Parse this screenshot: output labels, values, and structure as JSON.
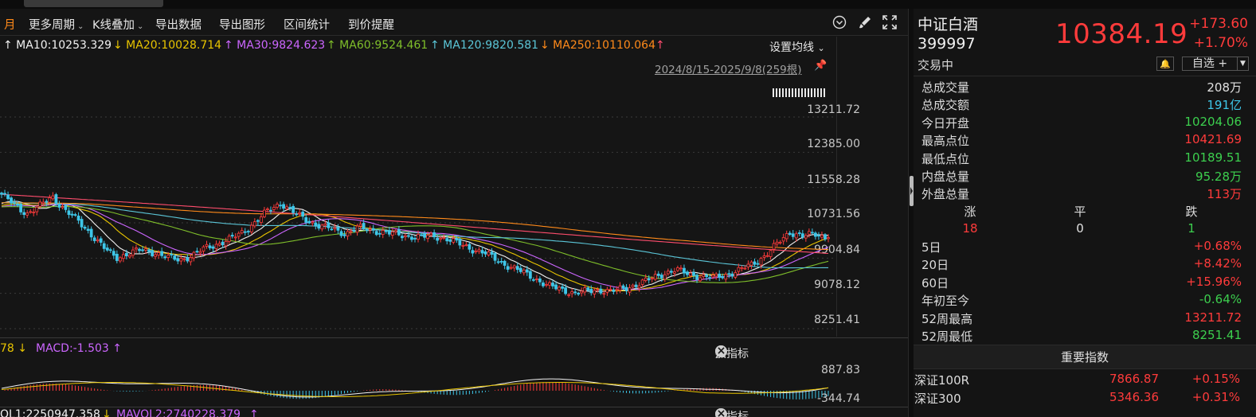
{
  "toolbar": {
    "period_partial": "月",
    "more_periods": "更多周期",
    "kline_overlay": "K线叠加",
    "export_data": "导出数据",
    "export_image": "导出图形",
    "range_stats": "区间统计",
    "price_alert": "到价提醒"
  },
  "ma": {
    "items": [
      {
        "label": "↑ MA10:10253.329",
        "color": "#f2f2f2"
      },
      {
        "label": "↓ MA20:10028.714",
        "color": "#e8c400"
      },
      {
        "label": "↑ MA30:9824.623",
        "color": "#cc66ff"
      },
      {
        "label": "↑ MA60:9524.461",
        "color": "#7fbf2a"
      },
      {
        "label": "↑ MA120:9820.581",
        "color": "#5bc6d8"
      },
      {
        "label": "↓ MA250:10110.064",
        "color": "#ff8a1a"
      },
      {
        "label": "↑",
        "color": "#ff4d6d"
      }
    ],
    "setting": "设置均线",
    "date_range": "2024/8/15-2025/9/8(259根)"
  },
  "price_axis": [
    "13211.72",
    "12385.00",
    "11558.28",
    "10731.56",
    "9904.84",
    "9078.12",
    "8251.41"
  ],
  "chart_data": {
    "type": "candlestick",
    "title": "",
    "period": "2024/8/15-2025/9/8",
    "bars": 259,
    "ylim": [
      8251.41,
      13211.72
    ],
    "price_ticks": [
      13211.72,
      12385.0,
      11558.28,
      10731.56,
      9904.84,
      9078.12,
      8251.41
    ],
    "last_close": 10384.19,
    "ma": {
      "MA10": 10253.329,
      "MA20": 10028.714,
      "MA30": 9824.623,
      "MA60": 9524.461,
      "MA120": 9820.581,
      "MA250": 10110.064
    },
    "close_path": [
      11400,
      11150,
      10950,
      11120,
      11350,
      11020,
      10780,
      10480,
      10150,
      9920,
      10010,
      10100,
      10040,
      9920,
      9870,
      9960,
      10140,
      10240,
      10350,
      10520,
      10760,
      11030,
      11200,
      10960,
      10790,
      10670,
      10580,
      10480,
      10620,
      10560,
      10520,
      10460,
      10420,
      10400,
      10420,
      10360,
      10230,
      10120,
      10020,
      9850,
      9700,
      9570,
      9420,
      9250,
      9170,
      9090,
      9120,
      9160,
      9130,
      9190,
      9300,
      9410,
      9540,
      9630,
      9530,
      9480,
      9440,
      9520,
      9620,
      9760,
      9960,
      10240,
      10520,
      10420,
      10460,
      10384
    ],
    "macd": {
      "MACD": -1.503,
      "ylim": [
        -344.74,
        887.83
      ]
    },
    "volume": {
      "MAVOL1": "1:2250947.358",
      "MAVOL2": "2:2740228.379"
    }
  },
  "macd": {
    "prefix": "78 ↓",
    "label": "MACD:-1.503 ↑",
    "axis_top": "887.83",
    "axis_bottom": "-344.74"
  },
  "indicator": {
    "add": "加指标",
    "switch": "换指标"
  },
  "vol": {
    "label1": "OL1:2250947.358",
    "arrow": "↓",
    "label2": "MAVOL2:2740228.379",
    "arrow2": "↑"
  },
  "quote": {
    "name": "中证白酒",
    "code": "399997",
    "price": "10384.19",
    "change": "+173.60",
    "pct": "+1.70%",
    "status": "交易中",
    "fav": "自选 +",
    "rows": [
      {
        "k": "总成交量",
        "v": "208万",
        "color": "#e0e0e0"
      },
      {
        "k": "总成交额",
        "v": "191亿",
        "color": "#3ec6e8"
      },
      {
        "k": "今日开盘",
        "v": "10204.06",
        "color": "#3ccf4e"
      },
      {
        "k": "最高点位",
        "v": "10421.69",
        "color": "#ff3b3b"
      },
      {
        "k": "最低点位",
        "v": "10189.51",
        "color": "#3ccf4e"
      },
      {
        "k": "内盘总量",
        "v": "95.28万",
        "color": "#3ccf4e"
      },
      {
        "k": "外盘总量",
        "v": "113万",
        "color": "#ff3b3b"
      }
    ],
    "breadth": {
      "up_label": "涨",
      "flat_label": "平",
      "down_label": "跌",
      "up": "18",
      "flat": "0",
      "down": "1"
    },
    "periods": [
      {
        "k": "5日",
        "v": "+0.68%",
        "color": "#ff3b3b"
      },
      {
        "k": "20日",
        "v": "+8.42%",
        "color": "#ff3b3b"
      },
      {
        "k": "60日",
        "v": "+15.96%",
        "color": "#ff3b3b"
      },
      {
        "k": "年初至今",
        "v": "-0.64%",
        "color": "#3ccf4e"
      },
      {
        "k": "52周最高",
        "v": "13211.72",
        "color": "#ff3b3b"
      },
      {
        "k": "52周最低",
        "v": "8251.41",
        "color": "#3ccf4e"
      }
    ],
    "index_header": "重要指数",
    "indices": [
      {
        "name": "深证100R",
        "price": "7866.87",
        "chg": "+0.15%"
      },
      {
        "name": "深证300",
        "price": "5346.36",
        "chg": "+0.31%"
      }
    ]
  }
}
